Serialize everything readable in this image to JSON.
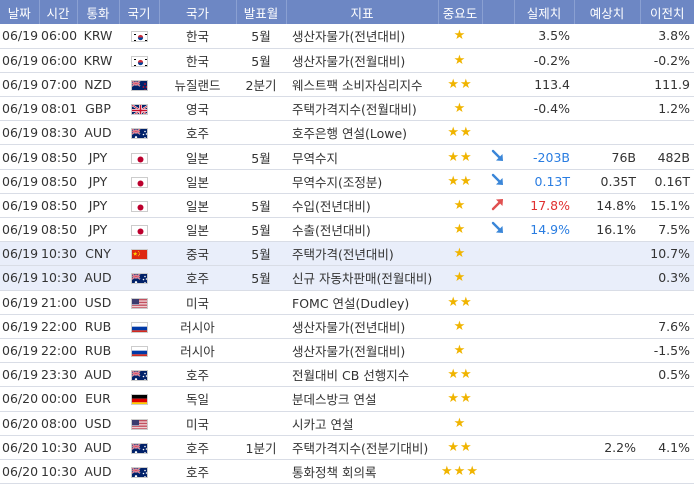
{
  "columns": [
    "날짜",
    "시간",
    "통화",
    "국기",
    "국가",
    "발표월",
    "지표",
    "중요도",
    "",
    "실제치",
    "예상치",
    "이전치"
  ],
  "flags": {
    "KRW": "kr-flag-icon",
    "NZD": "nz-flag-icon",
    "GBP": "gb-flag-icon",
    "AUD": "au-flag-icon",
    "JPY": "jp-flag-icon",
    "CNY": "cn-flag-icon",
    "USD": "us-flag-icon",
    "RUB": "ru-flag-icon",
    "EUR": "de-flag-icon"
  },
  "colors": {
    "header_bg": "#6d87c4",
    "row_highlight": "#e9eefa",
    "star": "#f0b400",
    "up": "#e03030",
    "down": "#2a7de1"
  },
  "rows": [
    {
      "date": "06/19",
      "time": "06:00",
      "cur": "KRW",
      "country": "한국",
      "month": "5월",
      "indicator": "생산자물가(전년대비)",
      "stars": "★",
      "dir": "",
      "actual": "3.5%",
      "actual_dir": "",
      "forecast": "",
      "previous": "3.8%",
      "hl": false
    },
    {
      "date": "06/19",
      "time": "06:00",
      "cur": "KRW",
      "country": "한국",
      "month": "5월",
      "indicator": "생산자물가(전월대비)",
      "stars": "★",
      "dir": "",
      "actual": "-0.2%",
      "actual_dir": "",
      "forecast": "",
      "previous": "-0.2%",
      "hl": false
    },
    {
      "date": "06/19",
      "time": "07:00",
      "cur": "NZD",
      "country": "뉴질랜드",
      "month": "2분기",
      "indicator": "웨스트팩 소비자심리지수",
      "stars": "★★",
      "dir": "",
      "actual": "113.4",
      "actual_dir": "",
      "forecast": "",
      "previous": "111.9",
      "hl": false
    },
    {
      "date": "06/19",
      "time": "08:01",
      "cur": "GBP",
      "country": "영국",
      "month": "",
      "indicator": "주택가격지수(전월대비)",
      "stars": "★",
      "dir": "",
      "actual": "-0.4%",
      "actual_dir": "",
      "forecast": "",
      "previous": "1.2%",
      "hl": false
    },
    {
      "date": "06/19",
      "time": "08:30",
      "cur": "AUD",
      "country": "호주",
      "month": "",
      "indicator": "호주은행 연설(Lowe)",
      "stars": "★★",
      "dir": "",
      "actual": "",
      "actual_dir": "",
      "forecast": "",
      "previous": "",
      "hl": false
    },
    {
      "date": "06/19",
      "time": "08:50",
      "cur": "JPY",
      "country": "일본",
      "month": "5월",
      "indicator": "무역수지",
      "stars": "★★",
      "dir": "down",
      "actual": "-203B",
      "actual_dir": "down",
      "forecast": "76B",
      "previous": "482B",
      "hl": false
    },
    {
      "date": "06/19",
      "time": "08:50",
      "cur": "JPY",
      "country": "일본",
      "month": "",
      "indicator": "무역수지(조정분)",
      "stars": "★★",
      "dir": "down",
      "actual": "0.13T",
      "actual_dir": "down",
      "forecast": "0.35T",
      "previous": "0.16T",
      "hl": false
    },
    {
      "date": "06/19",
      "time": "08:50",
      "cur": "JPY",
      "country": "일본",
      "month": "5월",
      "indicator": "수입(전년대비)",
      "stars": "★",
      "dir": "up",
      "actual": "17.8%",
      "actual_dir": "up",
      "forecast": "14.8%",
      "previous": "15.1%",
      "hl": false
    },
    {
      "date": "06/19",
      "time": "08:50",
      "cur": "JPY",
      "country": "일본",
      "month": "5월",
      "indicator": "수출(전년대비)",
      "stars": "★",
      "dir": "down",
      "actual": "14.9%",
      "actual_dir": "down",
      "forecast": "16.1%",
      "previous": "7.5%",
      "hl": false
    },
    {
      "date": "06/19",
      "time": "10:30",
      "cur": "CNY",
      "country": "중국",
      "month": "5월",
      "indicator": "주택가격(전년대비)",
      "stars": "★",
      "dir": "",
      "actual": "",
      "actual_dir": "",
      "forecast": "",
      "previous": "10.7%",
      "hl": true
    },
    {
      "date": "06/19",
      "time": "10:30",
      "cur": "AUD",
      "country": "호주",
      "month": "5월",
      "indicator": "신규 자동차판매(전월대비)",
      "stars": "★",
      "dir": "",
      "actual": "",
      "actual_dir": "",
      "forecast": "",
      "previous": "0.3%",
      "hl": true
    },
    {
      "date": "06/19",
      "time": "21:00",
      "cur": "USD",
      "country": "미국",
      "month": "",
      "indicator": "FOMC 연설(Dudley)",
      "stars": "★★",
      "dir": "",
      "actual": "",
      "actual_dir": "",
      "forecast": "",
      "previous": "",
      "hl": false
    },
    {
      "date": "06/19",
      "time": "22:00",
      "cur": "RUB",
      "country": "러시아",
      "month": "",
      "indicator": "생산자물가(전년대비)",
      "stars": "★",
      "dir": "",
      "actual": "",
      "actual_dir": "",
      "forecast": "",
      "previous": "7.6%",
      "hl": false
    },
    {
      "date": "06/19",
      "time": "22:00",
      "cur": "RUB",
      "country": "러시아",
      "month": "",
      "indicator": "생산자물가(전월대비)",
      "stars": "★",
      "dir": "",
      "actual": "",
      "actual_dir": "",
      "forecast": "",
      "previous": "-1.5%",
      "hl": false
    },
    {
      "date": "06/19",
      "time": "23:30",
      "cur": "AUD",
      "country": "호주",
      "month": "",
      "indicator": "전월대비 CB 선행지수",
      "stars": "★★",
      "dir": "",
      "actual": "",
      "actual_dir": "",
      "forecast": "",
      "previous": "0.5%",
      "hl": false
    },
    {
      "date": "06/20",
      "time": "00:00",
      "cur": "EUR",
      "country": "독일",
      "month": "",
      "indicator": "분데스방크 연설",
      "stars": "★★",
      "dir": "",
      "actual": "",
      "actual_dir": "",
      "forecast": "",
      "previous": "",
      "hl": false
    },
    {
      "date": "06/20",
      "time": "08:00",
      "cur": "USD",
      "country": "미국",
      "month": "",
      "indicator": "시카고 연설",
      "stars": "★",
      "dir": "",
      "actual": "",
      "actual_dir": "",
      "forecast": "",
      "previous": "",
      "hl": false
    },
    {
      "date": "06/20",
      "time": "10:30",
      "cur": "AUD",
      "country": "호주",
      "month": "1분기",
      "indicator": "주택가격지수(전분기대비)",
      "stars": "★★",
      "dir": "",
      "actual": "",
      "actual_dir": "",
      "forecast": "2.2%",
      "previous": "4.1%",
      "hl": false
    },
    {
      "date": "06/20",
      "time": "10:30",
      "cur": "AUD",
      "country": "호주",
      "month": "",
      "indicator": "통화정책 회의록",
      "stars": "★★★",
      "dir": "",
      "actual": "",
      "actual_dir": "",
      "forecast": "",
      "previous": "",
      "hl": false
    }
  ]
}
